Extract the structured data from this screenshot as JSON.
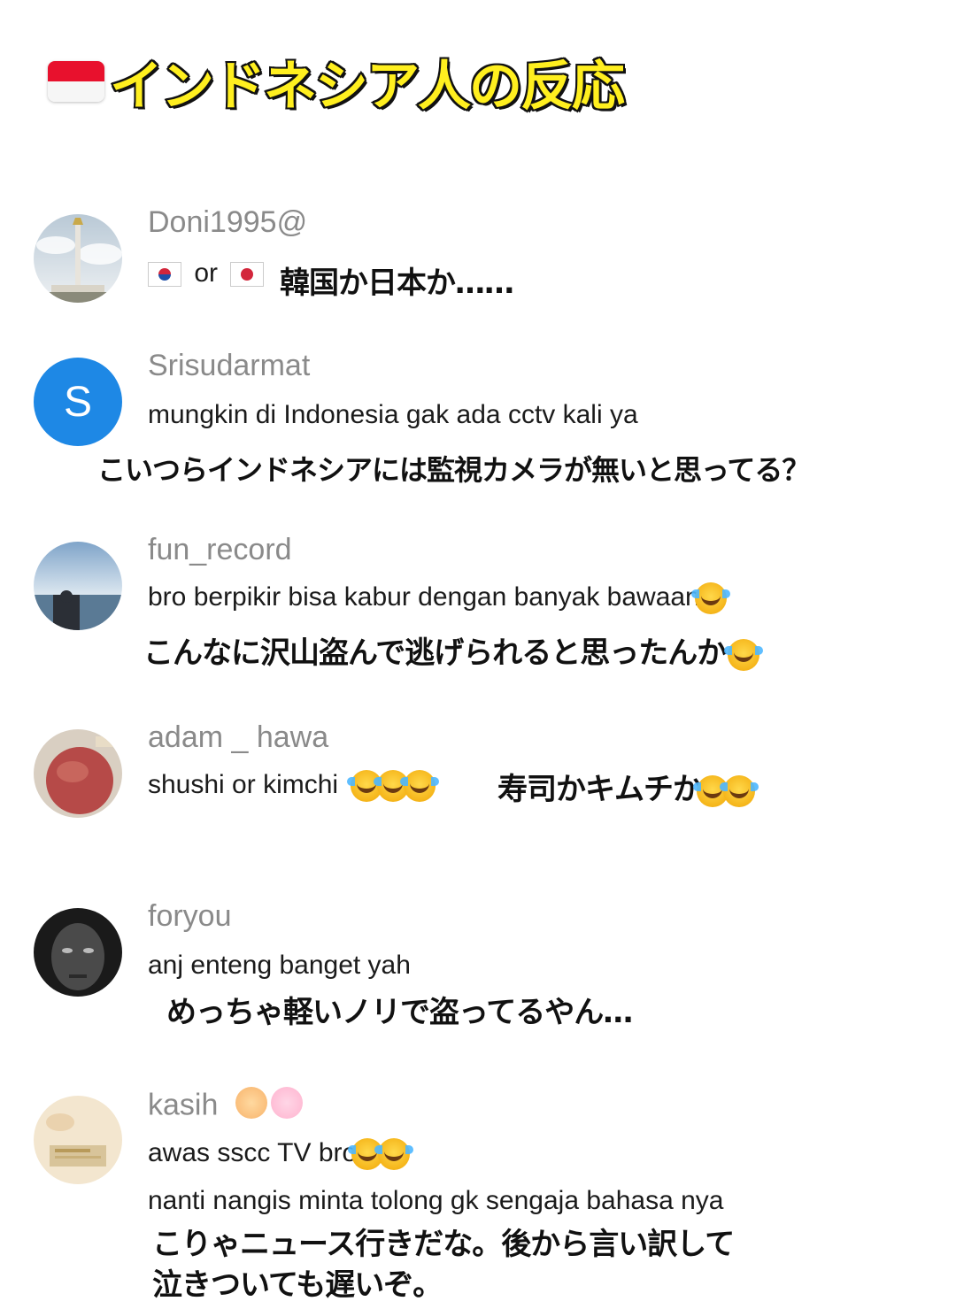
{
  "title": {
    "text": "インドネシア人の反応"
  },
  "comments": [
    {
      "username": "Doni1995@",
      "text_mid": "or",
      "jp": "韓国か日本か……",
      "avatar": "monument-icon"
    },
    {
      "username": "Srisudarmat",
      "text": "mungkin di Indonesia gak ada cctv kali ya",
      "jp": "こいつらインドネシアには監視カメラが無いと思ってる？",
      "avatar_letter": "S"
    },
    {
      "username": "fun_record",
      "text": "bro berpikir bisa kabur dengan banyak bawaan",
      "jp": "こんなに沢山盗んで逃げられると思ったんか"
    },
    {
      "username": "adam _ hawa",
      "text": "shushi or kimchi",
      "jp": "寿司かキムチか"
    },
    {
      "username": "foryou",
      "text": "anj enteng banget yah",
      "jp": "めっちゃ軽いノリで盗ってるやん…"
    },
    {
      "username": "kasih",
      "text": "awas sscc TV bro",
      "text2": "nanti nangis minta tolong gk sengaja bahasa nya",
      "jp_line1": "こりゃニュース行きだな。後から言い訳して",
      "jp_line2": "泣きついても遅いぞ。"
    }
  ],
  "colors": {
    "accent_avatar": "#1e88e5",
    "title_fill": "#ffef1f"
  }
}
